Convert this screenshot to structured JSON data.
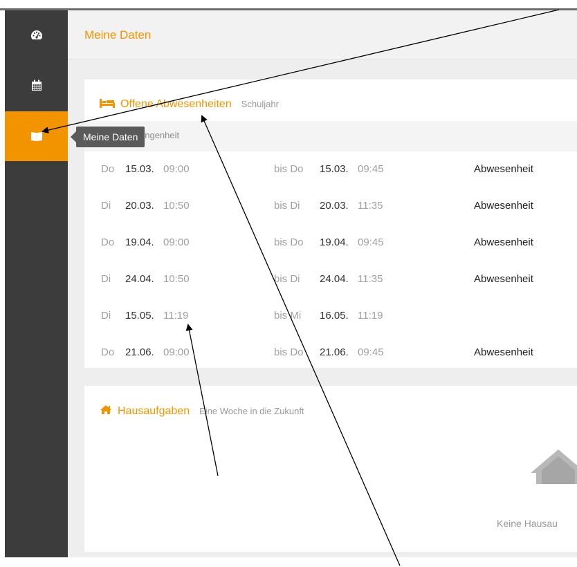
{
  "header": {
    "title": "Meine Daten"
  },
  "tooltip": {
    "text": "Meine Daten"
  },
  "absences": {
    "title": "Offene Abwesenheiten",
    "subtitle": "Schuljahr",
    "subbar_label": "angenheit",
    "rows": [
      {
        "from_wd": "Do",
        "from_date": "15.03.",
        "from_time": "09:00",
        "to_wd": "bis Do",
        "to_date": "15.03.",
        "to_time": "09:45",
        "type": "Abwesenheit"
      },
      {
        "from_wd": "Di",
        "from_date": "20.03.",
        "from_time": "10:50",
        "to_wd": "bis Di",
        "to_date": "20.03.",
        "to_time": "11:35",
        "type": "Abwesenheit"
      },
      {
        "from_wd": "Do",
        "from_date": "19.04.",
        "from_time": "09:00",
        "to_wd": "bis Do",
        "to_date": "19.04.",
        "to_time": "09:45",
        "type": "Abwesenheit"
      },
      {
        "from_wd": "Di",
        "from_date": "24.04.",
        "from_time": "10:50",
        "to_wd": "bis Di",
        "to_date": "24.04.",
        "to_time": "11:35",
        "type": "Abwesenheit"
      },
      {
        "from_wd": "Di",
        "from_date": "15.05.",
        "from_time": "11:19",
        "to_wd": "bis Mi",
        "to_date": "16.05.",
        "to_time": "11:19",
        "type": ""
      },
      {
        "from_wd": "Do",
        "from_date": "21.06.",
        "from_time": "09:00",
        "to_wd": "bis Do",
        "to_date": "21.06.",
        "to_time": "09:45",
        "type": "Abwesenheit"
      }
    ]
  },
  "homework": {
    "title": "Hausaufgaben",
    "subtitle": "Eine Woche in die Zukunft",
    "empty_text": "Keine Hausau"
  },
  "icons": {
    "dashboard": "dashboard-icon",
    "calendar": "calendar-icon",
    "book": "book-icon",
    "bed": "bed-icon",
    "home": "home-icon"
  },
  "colors": {
    "accent": "#f29400",
    "sidebar": "#3c3c3c",
    "tooltip": "#5a5a5a"
  }
}
